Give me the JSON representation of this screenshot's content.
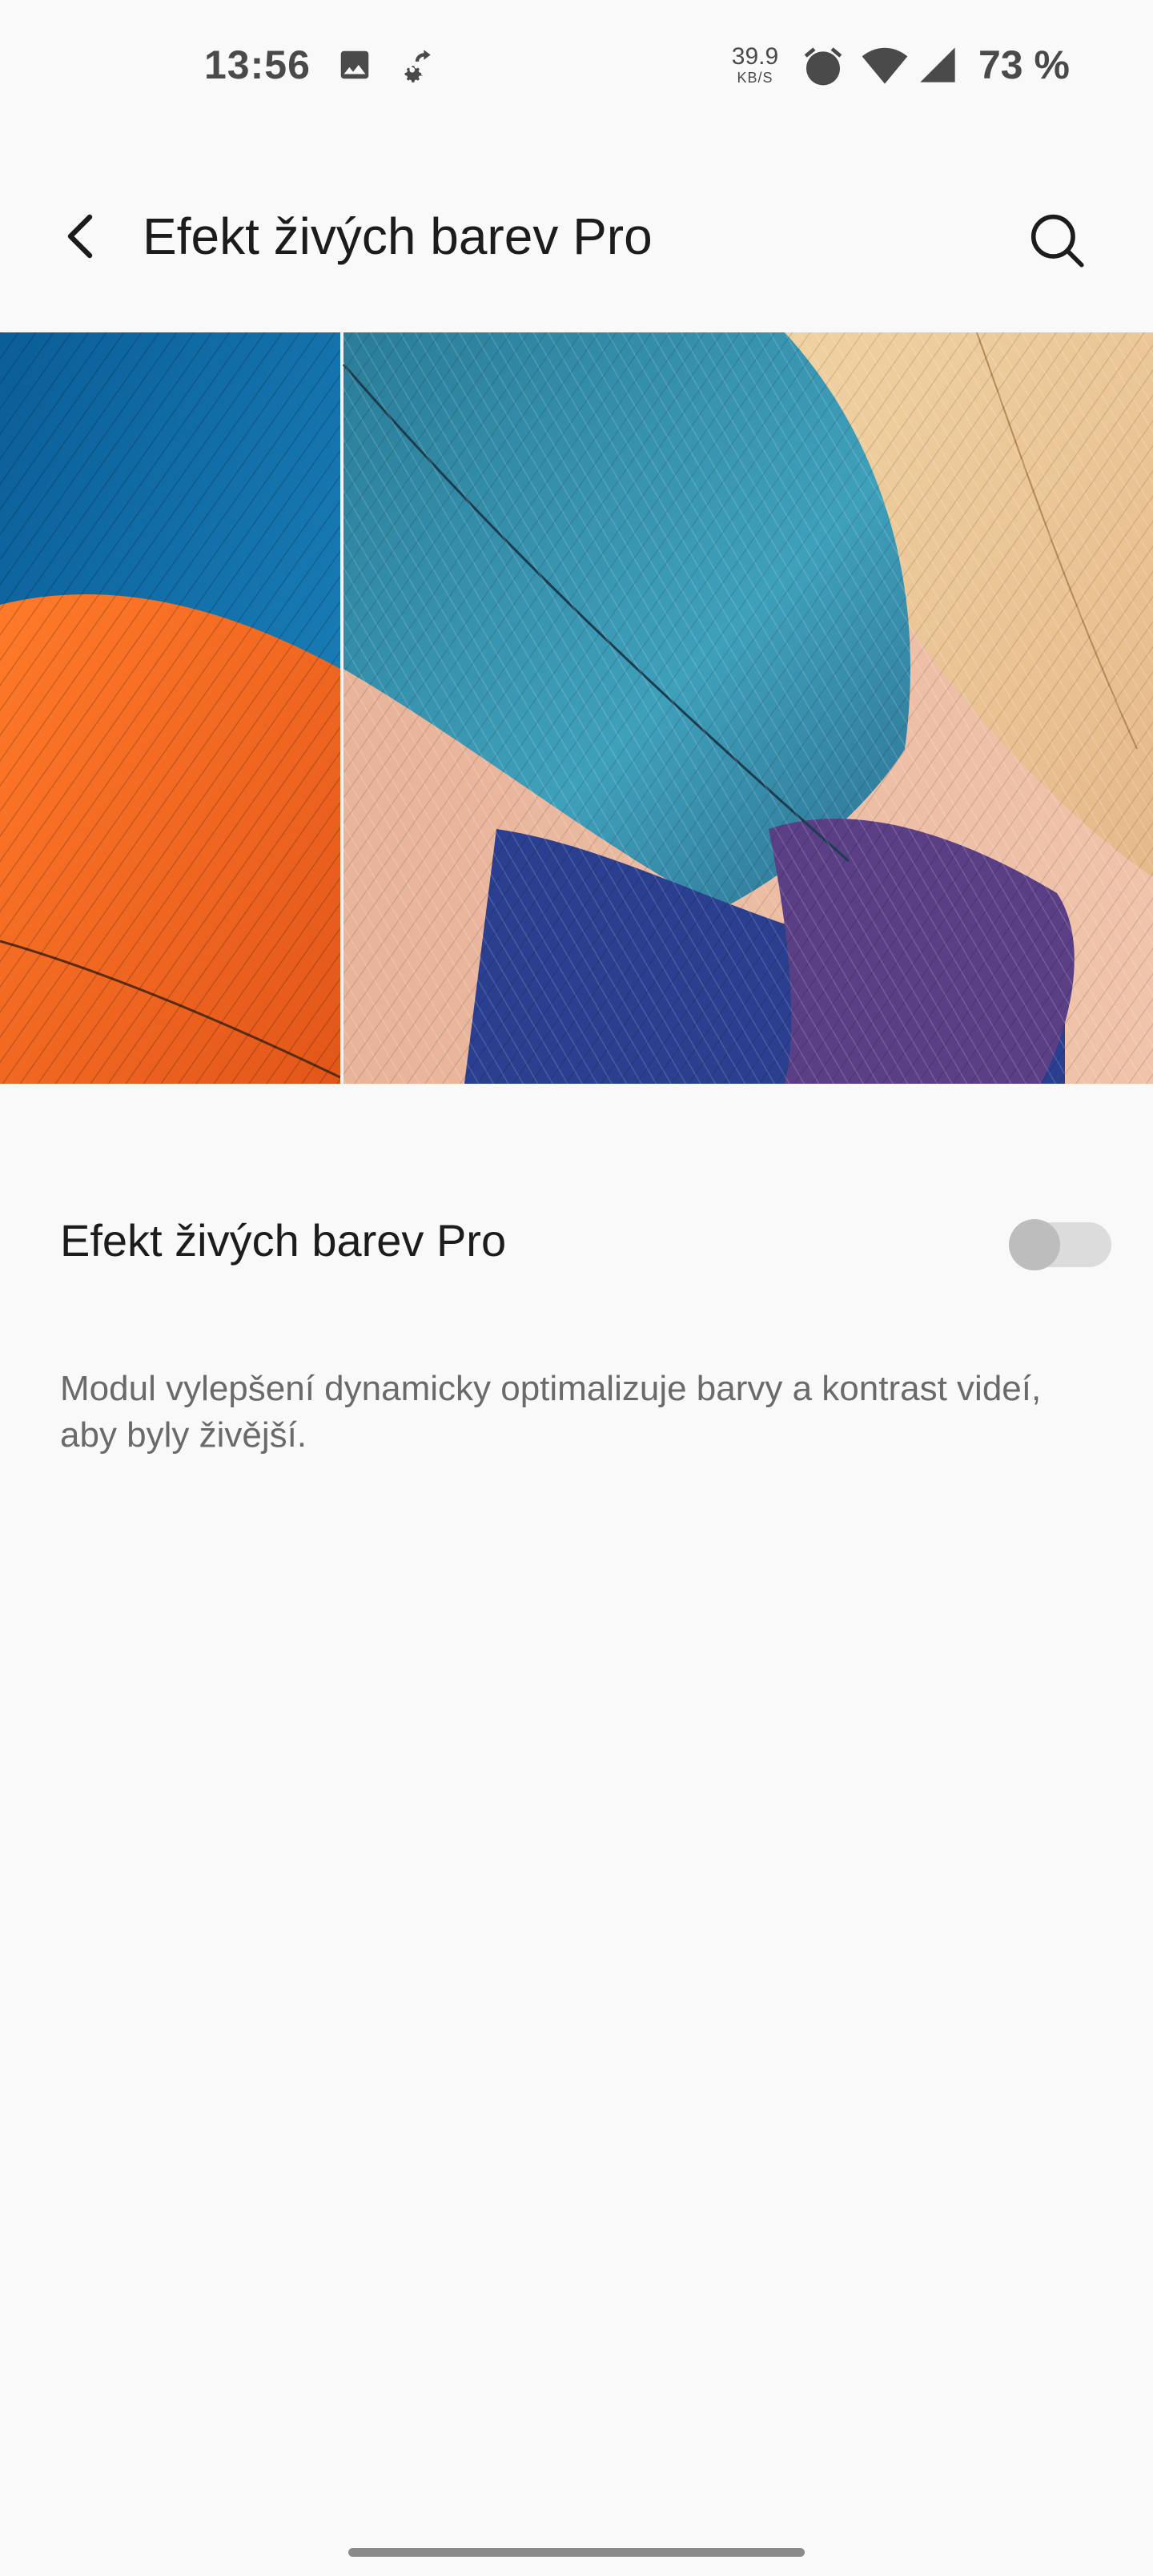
{
  "status_bar": {
    "time": "13:56",
    "net_speed_value": "39.9",
    "net_speed_unit": "KB/S",
    "battery": "73 %",
    "icons": [
      "image-icon",
      "settings-sync-icon",
      "alarm-icon",
      "wifi-icon",
      "signal-icon"
    ]
  },
  "app_bar": {
    "title": "Efekt živých barev Pro",
    "back_icon": "back-arrow-icon",
    "search_icon": "search-icon"
  },
  "preview": {
    "description": "feather-comparison-image"
  },
  "setting": {
    "label": "Efekt živých barev Pro",
    "toggle_on": false
  },
  "description": "Modul vylepšení dynamicky optimalizuje barvy a kontrast videí, aby byly živější.",
  "colors": {
    "background": "#f9f9f9",
    "text_primary": "#1c1c1c",
    "text_secondary": "#6a6a6a",
    "toggle_track": "#dcdcdc",
    "toggle_thumb": "#bdbdbd"
  }
}
